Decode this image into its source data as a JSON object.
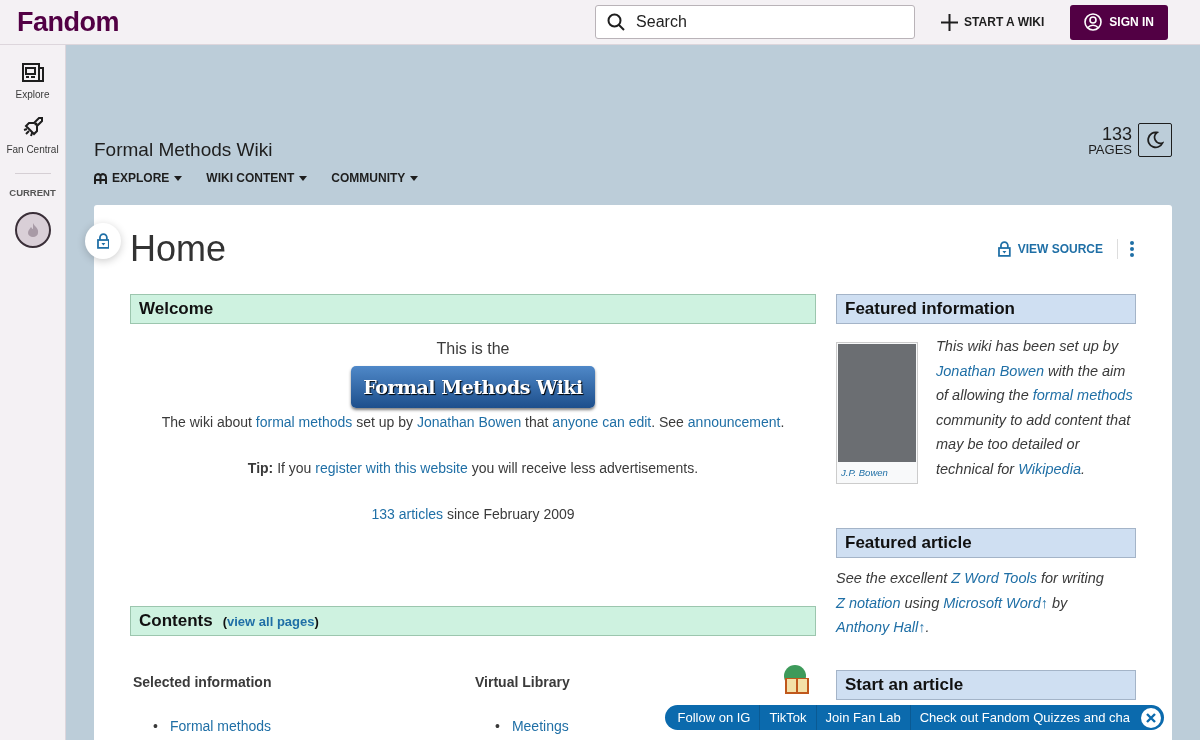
{
  "topbar": {
    "logo": "Fandom",
    "search": {
      "placeholder": "Search"
    },
    "start_wiki": "START A WIKI",
    "sign_in": "SIGN IN"
  },
  "sidebar": {
    "items": [
      {
        "kind": "explore",
        "label": "Explore"
      },
      {
        "kind": "rocket",
        "label": "Fan Central"
      }
    ],
    "current_label": "CURRENT"
  },
  "wiki_header": {
    "title": "Formal Methods Wiki",
    "nav": [
      {
        "label": "EXPLORE",
        "icon": true
      },
      {
        "label": "WIKI CONTENT",
        "icon": false
      },
      {
        "label": "COMMUNITY",
        "icon": false
      }
    ],
    "page_count": "133",
    "page_count_label": "PAGES"
  },
  "article": {
    "title": "Home",
    "view_source": "VIEW SOURCE",
    "welcome": {
      "heading": "Welcome",
      "intro": "This is the",
      "banner": "Formal Methods Wiki",
      "lines": [
        [
          {
            "text": "The wiki about "
          },
          {
            "text": "formal methods",
            "link": true
          },
          {
            "text": " set up by "
          },
          {
            "text": "Jonathan Bowen",
            "link": true
          },
          {
            "text": " that "
          },
          {
            "text": "anyone can edit",
            "link": true
          },
          {
            "text": ". See "
          },
          {
            "text": "announcement",
            "link": true
          },
          {
            "text": "."
          }
        ],
        [
          {
            "text": "**Tip:** If you "
          },
          {
            "text": "register with this website",
            "link": true
          },
          {
            "text": " you will receive less advertisements."
          }
        ],
        [
          {
            "text": "133 articles",
            "link": true
          },
          {
            "text": " since February 2009"
          }
        ]
      ]
    },
    "contents": {
      "heading": "Contents",
      "note": [
        {
          "text": "("
        },
        {
          "text": "view all pages",
          "link": true
        },
        {
          "text": ")"
        }
      ],
      "columns": [
        {
          "title": "Selected information",
          "items": [
            {
              "bullet": "•",
              "text": "Formal methods"
            }
          ]
        },
        {
          "title": "Virtual Library",
          "items": [
            {
              "bullet": "•",
              "text": "Meetings"
            }
          ]
        }
      ]
    },
    "sidebar_boxes": [
      {
        "heading": "Featured information",
        "photo_caption": "J.P. Bowen",
        "parts": [
          {
            "text": "This wiki has been set up by "
          },
          {
            "text": "Jonathan Bowen",
            "link": true
          },
          {
            "text": " with the aim of allowing the "
          },
          {
            "text": "formal methods",
            "link": true
          },
          {
            "text": " community to add content that may be too detailed or technical for "
          },
          {
            "text": "Wikipedia",
            "link": true
          },
          {
            "text": "."
          }
        ]
      },
      {
        "heading": "Featured article",
        "parts": [
          {
            "text": "See the excellent "
          },
          {
            "text": "Z Word Tools",
            "link": true
          },
          {
            "text": " for writing "
          },
          {
            "text": "Z notation",
            "link": true
          },
          {
            "text": " using "
          },
          {
            "text": "Microsoft Word↑",
            "link": true
          },
          {
            "text": " by "
          },
          {
            "text": "Anthony Hall↑",
            "link": true
          },
          {
            "text": "."
          }
        ]
      },
      {
        "heading": "Start an article"
      }
    ]
  },
  "social_bar": {
    "items": [
      "Follow on IG",
      "TikTok",
      "Join Fan Lab",
      "Check out Fandom Quizzes and cha"
    ]
  }
}
